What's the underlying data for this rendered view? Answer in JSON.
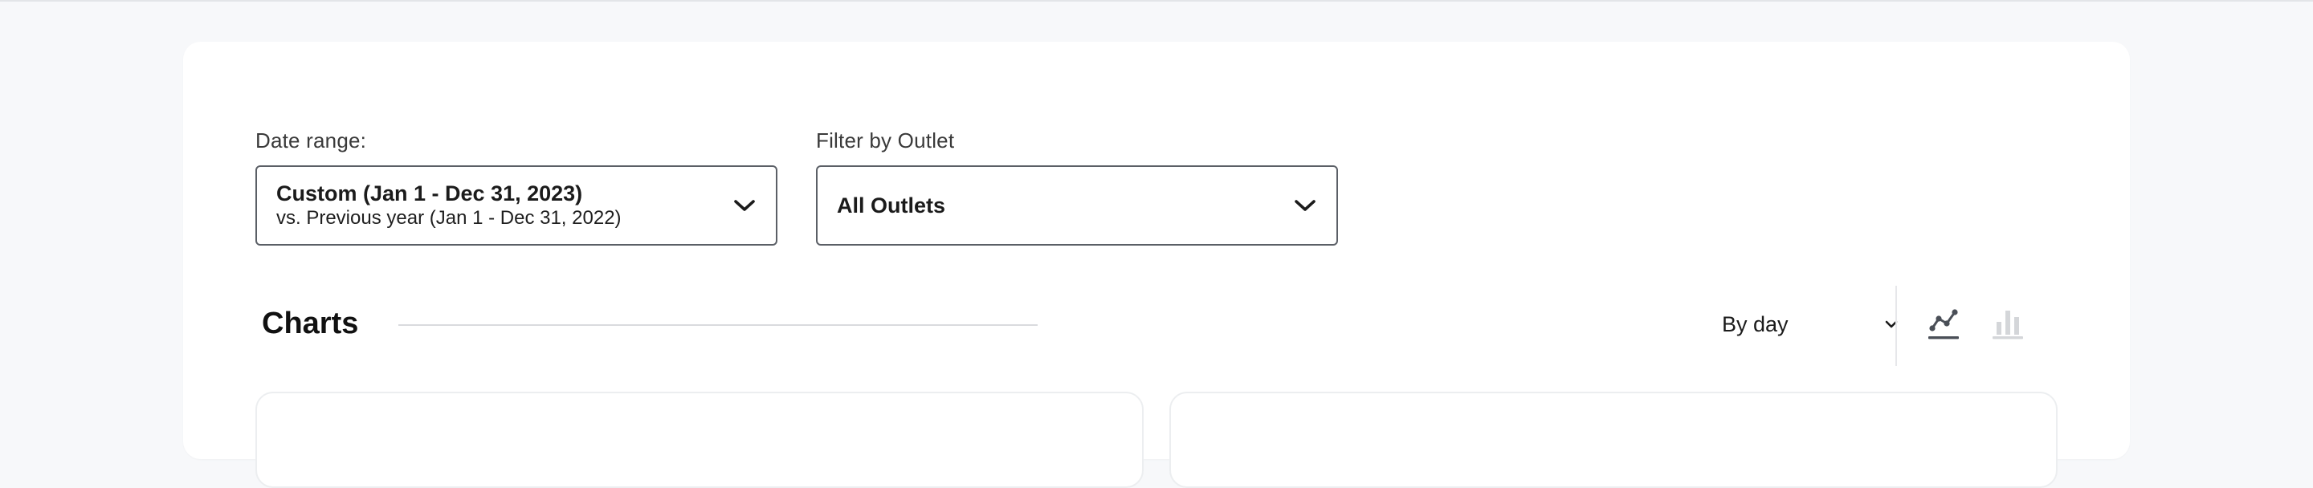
{
  "filters": {
    "date_range": {
      "label": "Date range:",
      "primary": "Custom (Jan 1 - Dec 31, 2023)",
      "secondary": "vs. Previous year (Jan 1 - Dec 31, 2022)"
    },
    "outlet": {
      "label": "Filter by Outlet",
      "value": "All Outlets"
    }
  },
  "charts": {
    "title": "Charts",
    "granularity": "By day",
    "view_modes": [
      {
        "icon": "line-chart-icon",
        "active": true
      },
      {
        "icon": "bar-chart-icon",
        "active": false
      }
    ]
  },
  "colors": {
    "active_icon": "#4a4f57",
    "inactive_icon": "#d4d6d9",
    "border": "#5b5f66"
  }
}
